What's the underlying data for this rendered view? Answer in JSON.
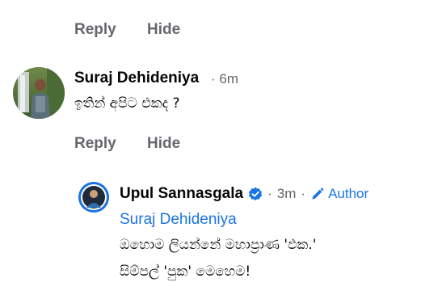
{
  "top_actions": {
    "reply_label": "Reply",
    "hide_label": "Hide"
  },
  "comment": {
    "author": "Suraj Dehideniya",
    "time": "6m",
    "separator": "·",
    "text": "ඉතින් අපිට එකද ?",
    "reply_label": "Reply",
    "hide_label": "Hide"
  },
  "reply": {
    "author": "Upul Sannasgala",
    "verified_icon": "verified-badge-icon",
    "time": "3m",
    "separator_1": "·",
    "separator_2": "·",
    "author_badge": "Author",
    "mention": "Suraj Dehideniya",
    "line1": "ඔහොම ලියන්නේ මහාප්‍රාණ 'ඵක.'",
    "line2": "සිම්පල් 'පුක' මෙහෙම!"
  },
  "colors": {
    "muted_text": "#65676b",
    "link_blue": "#1b74e4",
    "primary_text": "#050505"
  }
}
